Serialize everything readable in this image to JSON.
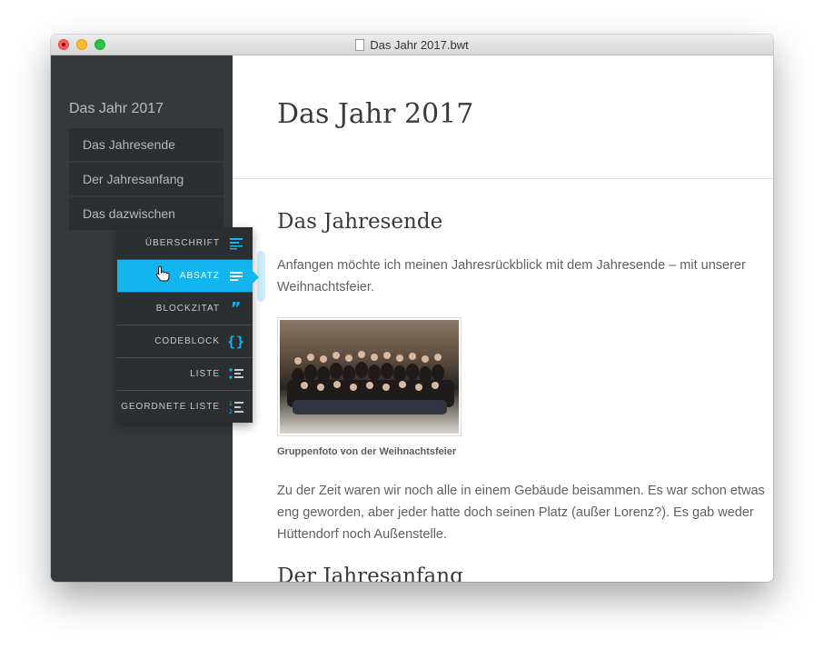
{
  "window": {
    "title": "Das Jahr 2017.bwt"
  },
  "sidebar": {
    "title": "Das Jahr 2017",
    "items": [
      {
        "label": "Das Jahresende"
      },
      {
        "label": "Der Jahresanfang"
      },
      {
        "label": "Das dazwischen"
      }
    ]
  },
  "block_menu": {
    "items": [
      {
        "label": "ÜBERSCHRIFT",
        "icon": "heading-lines-icon"
      },
      {
        "label": "ABSATZ",
        "icon": "paragraph-lines-icon",
        "active": true
      },
      {
        "label": "BLOCKZITAT",
        "icon": "quote-icon"
      },
      {
        "label": "CODEBLOCK",
        "icon": "braces-icon"
      },
      {
        "label": "LISTE",
        "icon": "bullet-list-icon"
      },
      {
        "label": "GEORDNETE LISTE",
        "icon": "numbered-list-icon"
      }
    ]
  },
  "document": {
    "title": "Das Jahr 2017",
    "section1": {
      "heading": "Das Jahresende",
      "para1": "Anfangen möchte ich meinen Jahresrückblick mit dem Jahresende – mit unserer Weihnachtsfeier.",
      "caption": "Gruppenfoto von der Weihnachtsfeier",
      "para2": "Zu der Zeit waren wir noch alle in einem Gebäude beisammen. Es war schon etwas eng geworden, aber jeder hatte doch seinen Platz (außer Lorenz?). Es gab weder Hüttendorf noch Außenstelle."
    },
    "section2": {
      "heading": "Der Jahresanfang"
    }
  },
  "colors": {
    "accent": "#12b5ee",
    "sidebar_bg": "#36393c",
    "menu_bg": "#2c2f32"
  }
}
